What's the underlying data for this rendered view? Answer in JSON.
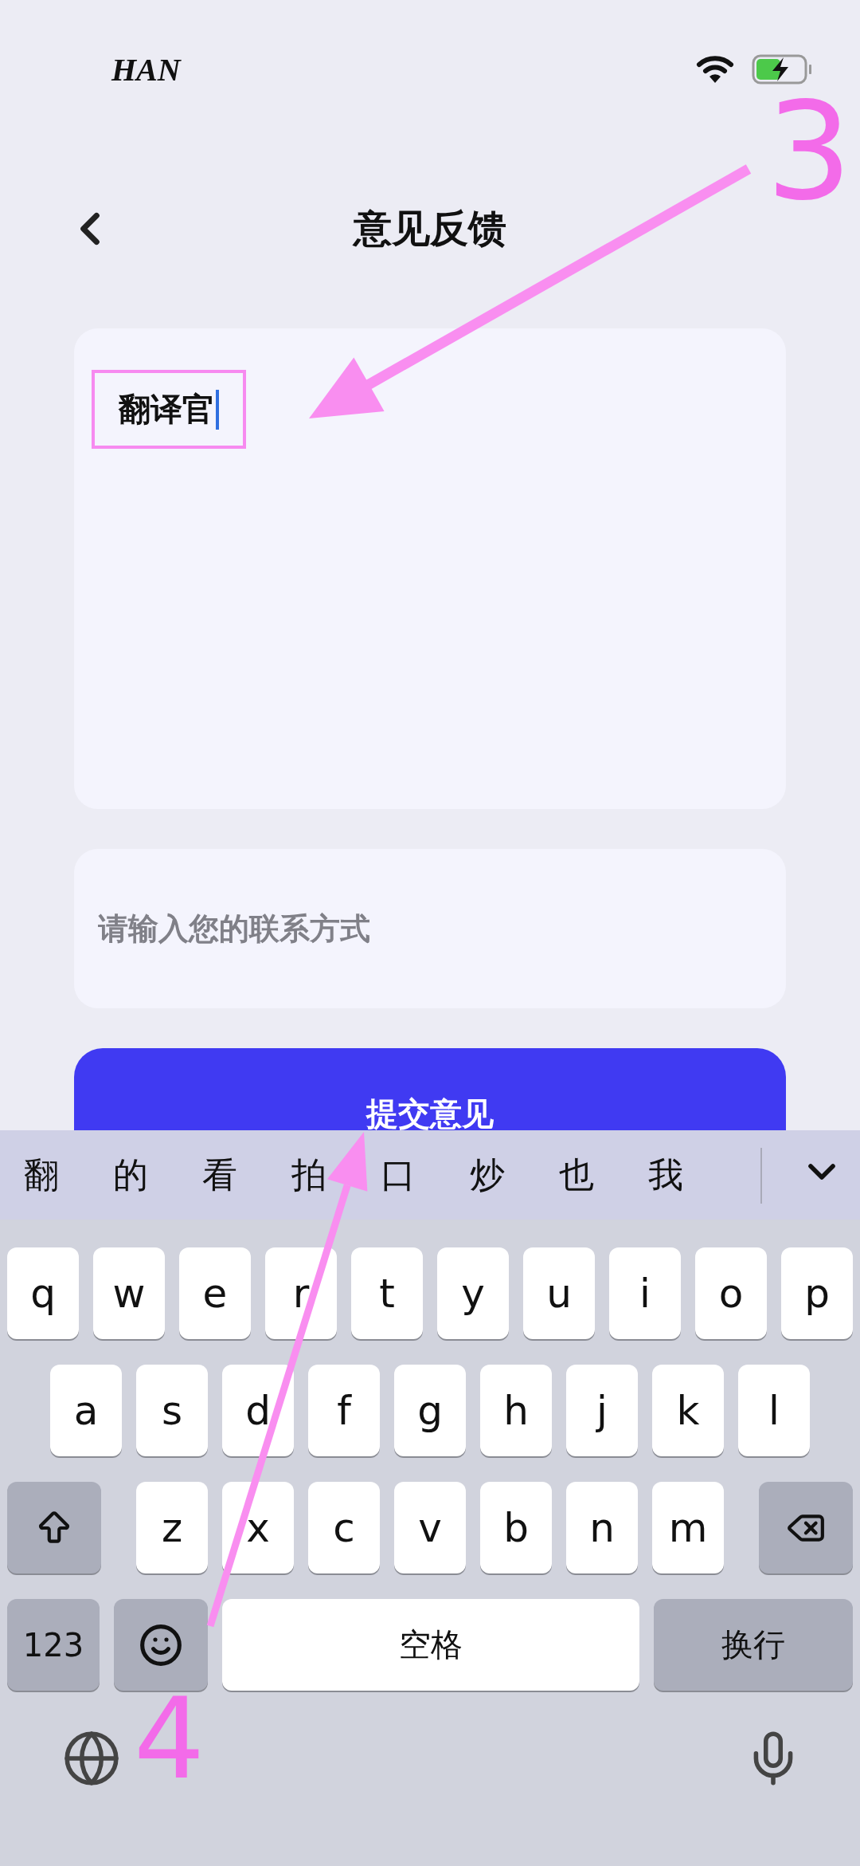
{
  "status_bar": {
    "carrier": "HAN",
    "charging": true
  },
  "header": {
    "title": "意见反馈"
  },
  "feedback_field": {
    "value": "翻译官",
    "focused": true,
    "highlighted": true
  },
  "contact_field": {
    "placeholder": "请输入您的联系方式"
  },
  "submit_button": {
    "label": "提交意见"
  },
  "keyboard": {
    "candidates": [
      "翻",
      "的",
      "看",
      "拍",
      "口",
      "炒",
      "也",
      "我"
    ],
    "letter_rows": [
      [
        "q",
        "w",
        "e",
        "r",
        "t",
        "y",
        "u",
        "i",
        "o",
        "p"
      ],
      [
        "a",
        "s",
        "d",
        "f",
        "g",
        "h",
        "j",
        "k",
        "l"
      ],
      [
        "z",
        "x",
        "c",
        "v",
        "b",
        "n",
        "m"
      ]
    ],
    "number_key": "123",
    "space_key": "空格",
    "return_key": "换行"
  },
  "annotations": [
    {
      "kind": "arrow",
      "label": "3"
    },
    {
      "kind": "arrow",
      "label": "4"
    }
  ]
}
